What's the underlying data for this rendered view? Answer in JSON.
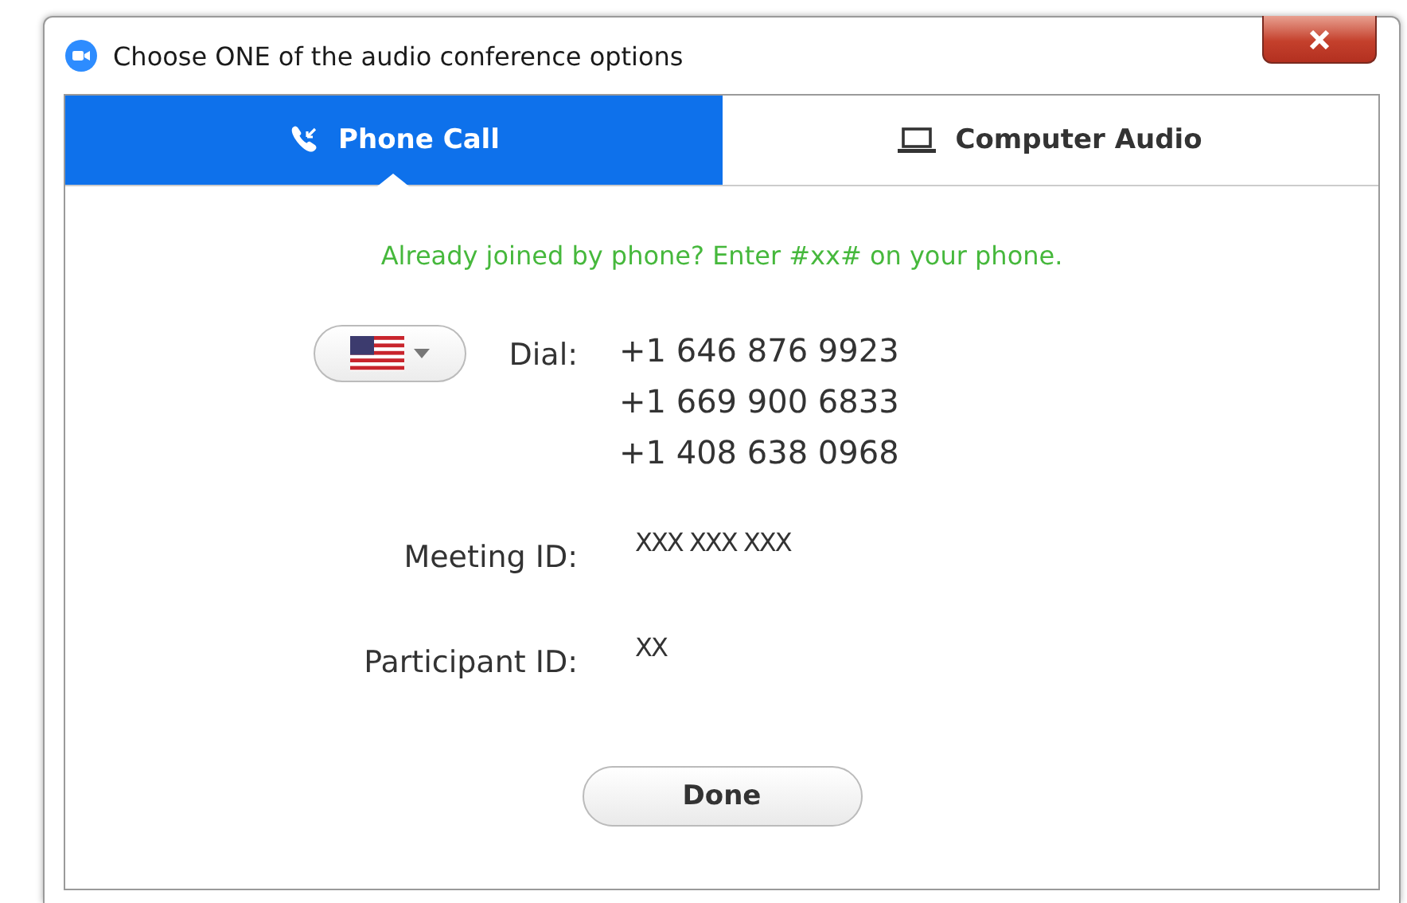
{
  "window": {
    "title": "Choose ONE of the audio conference options"
  },
  "tabs": [
    {
      "label": "Phone Call",
      "kind": "phone",
      "selected": true
    },
    {
      "label": "Computer Audio",
      "kind": "computer",
      "selected": false
    }
  ],
  "hint": "Already joined by phone? Enter #xx# on your phone.",
  "dial": {
    "label": "Dial:",
    "numbers": [
      "+1 646 876 9923",
      "+1 669 900 6833",
      "+1 408 638 0968"
    ]
  },
  "fields": [
    {
      "label": "Meeting ID:",
      "value": "XXX XXX XXX"
    },
    {
      "label": "Participant ID:",
      "value": "XX"
    }
  ],
  "buttons": [
    "Done"
  ]
}
